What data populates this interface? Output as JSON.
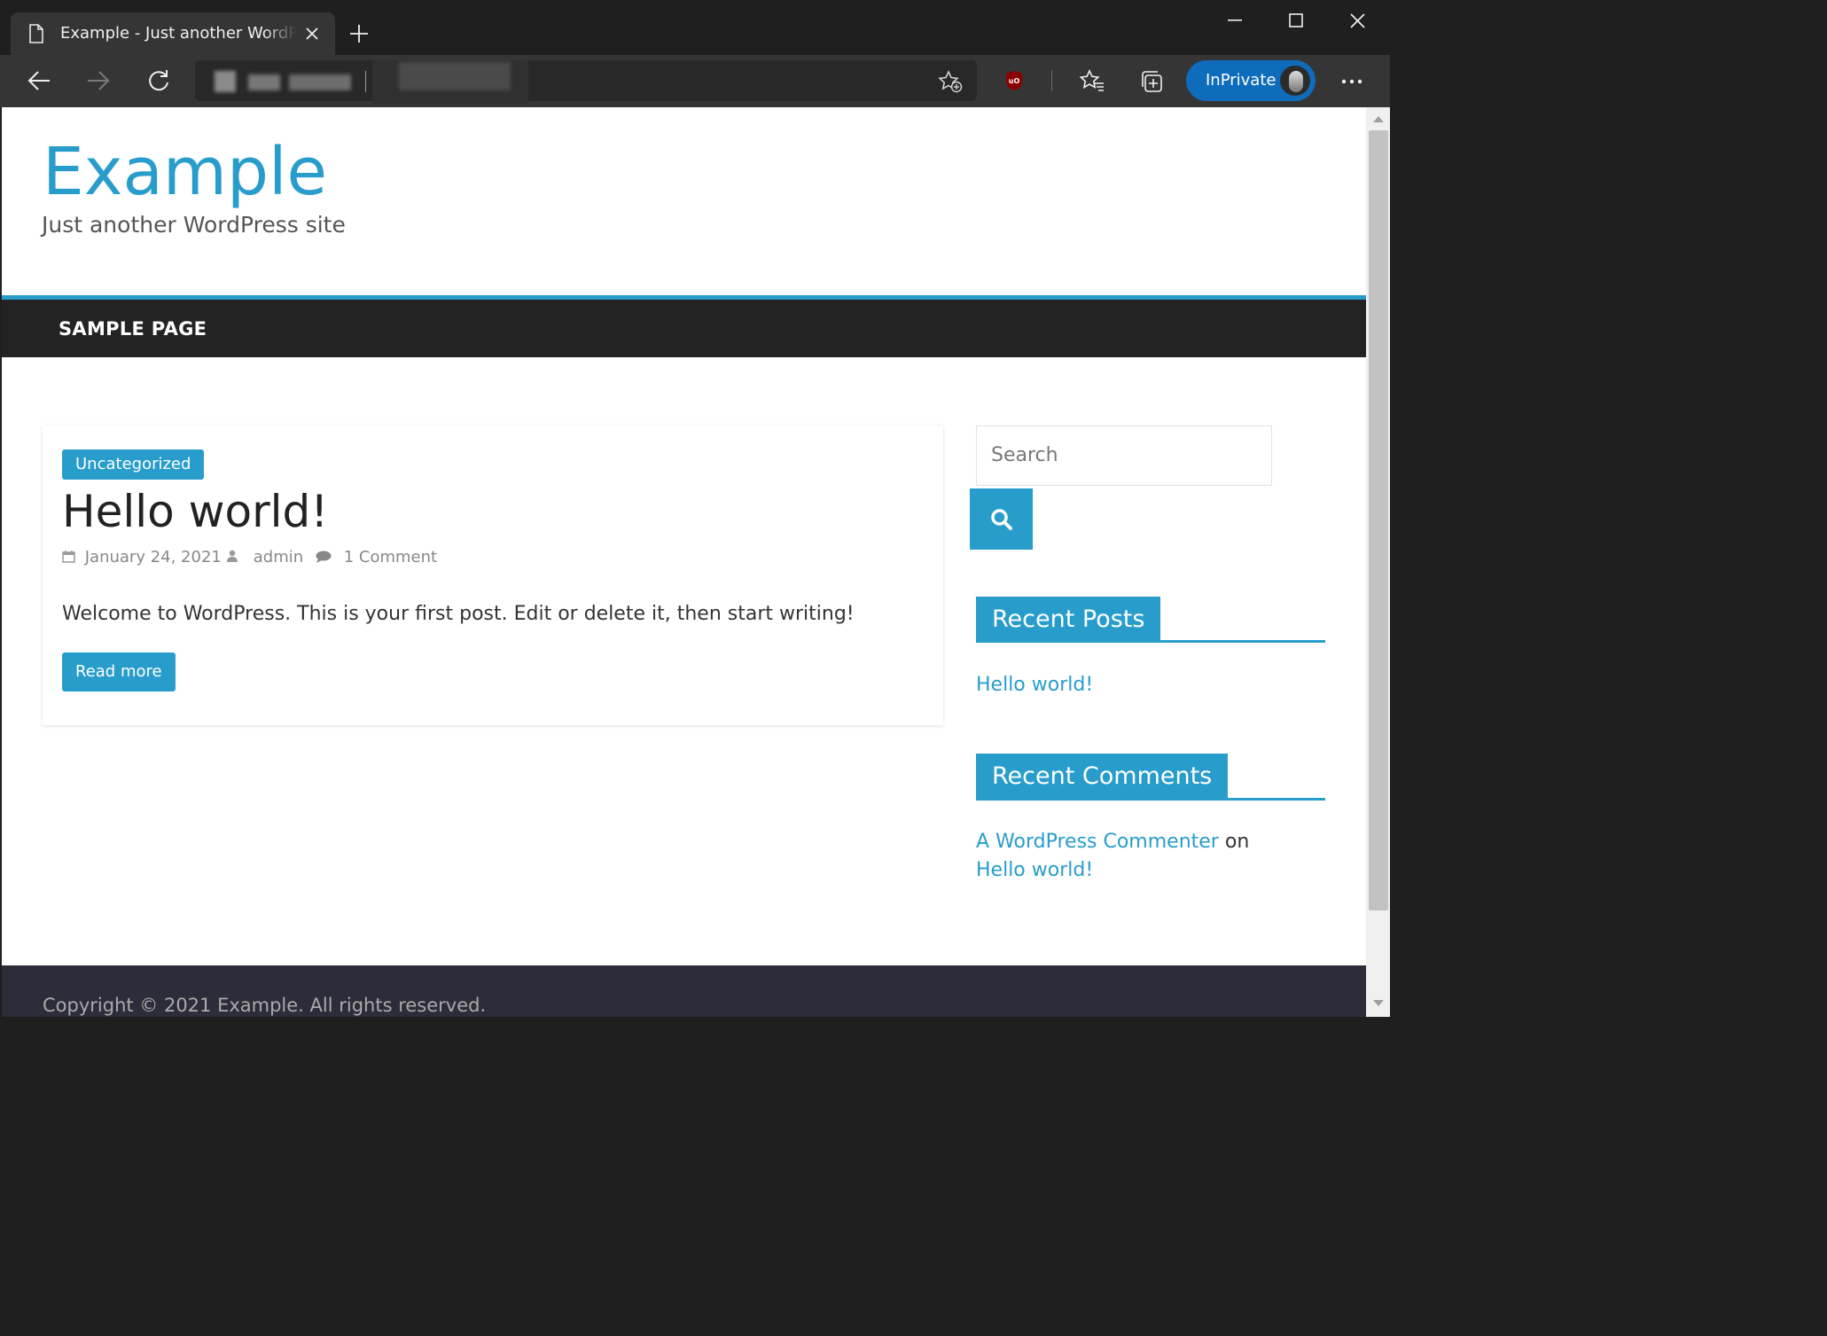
{
  "browser": {
    "tab_title": "Example - Just another WordPress site",
    "inprivate_label": "InPrivate"
  },
  "site": {
    "title": "Example",
    "description": "Just another WordPress site"
  },
  "nav": {
    "items": [
      {
        "label": "SAMPLE PAGE"
      }
    ]
  },
  "post": {
    "category": "Uncategorized",
    "title": "Hello world!",
    "date": "January 24, 2021",
    "author": "admin",
    "comments": "1 Comment",
    "excerpt": "Welcome to WordPress. This is your first post. Edit or delete it, then start writing!",
    "read_more": "Read more"
  },
  "sidebar": {
    "search_placeholder": "Search",
    "recent_posts": {
      "title": "Recent Posts",
      "items": [
        "Hello world!"
      ]
    },
    "recent_comments": {
      "title": "Recent Comments",
      "items": [
        {
          "author": "A WordPress Commenter",
          "on": "on",
          "post": "Hello world!"
        }
      ]
    }
  },
  "footer": {
    "copyright": "Copyright © 2021 Example. All rights reserved."
  },
  "colors": {
    "accent": "#289dcc",
    "nav_bg": "#232323",
    "footer_bg": "#2d2d3a",
    "inprivate": "#0f6cbd"
  }
}
